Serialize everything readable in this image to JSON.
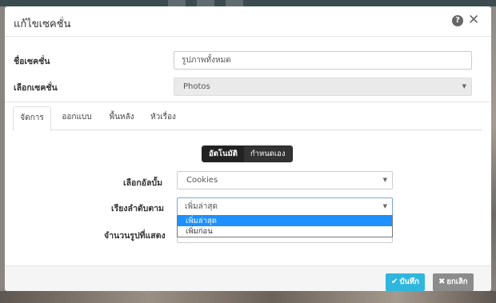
{
  "modal": {
    "title": "แก้ไขเซคชั่น"
  },
  "form": {
    "section_name_label": "ชื่อเซคชั่น",
    "section_name_value": "รูปภาพทั้งหมด",
    "section_type_label": "เลือกเซคชั่น",
    "section_type_value": "Photos"
  },
  "tabs": [
    {
      "label": "จัดการ",
      "active": true
    },
    {
      "label": "ออกแบบ",
      "active": false
    },
    {
      "label": "พื้นหลัง",
      "active": false
    },
    {
      "label": "หัวเรื่อง",
      "active": false
    }
  ],
  "toggle": {
    "auto_label": "อัตโนมัติ",
    "manual_label": "กำหนดเอง"
  },
  "manage": {
    "album_label": "เลือกอัลบั้ม",
    "album_value": "Cookies",
    "sort_label": "เรียงลำดับตาม",
    "sort_value": "เพิ่มล่าสุด",
    "sort_options": [
      "เพิ่มล่าสุด",
      "เพิ่มก่อน"
    ],
    "count_label": "จำนวนรูปที่แสดง"
  },
  "footer": {
    "save_label": "บันทึก",
    "cancel_label": "ยกเลิก"
  },
  "colors": {
    "save_button": "#2fb6dd",
    "cancel_button": "#8c8c8c",
    "selected_option": "#1e90ff",
    "toggle_dark": "#222222"
  }
}
